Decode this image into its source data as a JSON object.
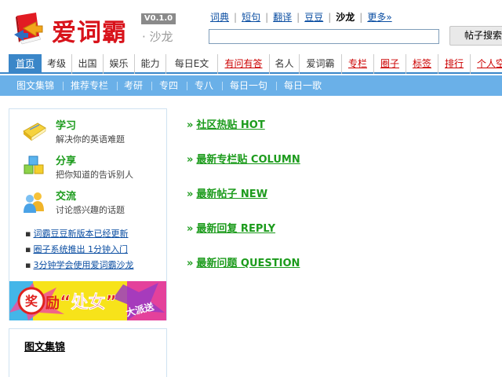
{
  "header": {
    "logo_text": "爱词霸",
    "version": "V0.1.0",
    "salon_label": "· 沙龙",
    "topnav": [
      {
        "label": "词典",
        "underline": true
      },
      {
        "label": "短句",
        "underline": true
      },
      {
        "label": "翻译",
        "underline": true
      },
      {
        "label": "豆豆",
        "underline": true
      },
      {
        "label": "沙龙",
        "active": true
      },
      {
        "label": "更多»",
        "underline": true
      }
    ],
    "search_placeholder": "",
    "search_button": "帖子搜索"
  },
  "mainnav": [
    {
      "label": "首页",
      "style": "home"
    },
    {
      "label": "考级"
    },
    {
      "label": "出国"
    },
    {
      "label": "娱乐"
    },
    {
      "label": "能力"
    },
    {
      "label": "每日E文"
    },
    {
      "label": "有问有答",
      "style": "red"
    },
    {
      "label": "名人"
    },
    {
      "label": "爱词霸"
    },
    {
      "label": "专栏",
      "style": "red"
    },
    {
      "label": "圈子",
      "style": "red"
    },
    {
      "label": "标签",
      "style": "red"
    },
    {
      "label": "排行",
      "style": "red"
    },
    {
      "label": "个人空",
      "style": "red"
    }
  ],
  "subnav": [
    "图文集锦",
    "推荐专栏",
    "考研",
    "专四",
    "专八",
    "每日一句",
    "每日一歌"
  ],
  "sidebar": {
    "features": [
      {
        "title": "学习",
        "desc": "解决你的英语难题",
        "icon": "book-icon"
      },
      {
        "title": "分享",
        "desc": "把你知道的告诉别人",
        "icon": "cubes-icon"
      },
      {
        "title": "交流",
        "desc": "讨论感兴趣的话题",
        "icon": "people-icon"
      }
    ],
    "news": [
      "词霸豆豆新版本已经更新",
      "圈子系统推出 1分钟入门",
      "3分钟学会使用爱词霸沙龙"
    ],
    "banner_text_1": "奖",
    "banner_text_2": "励",
    "banner_text_3": "“处女”",
    "banner_text_4": "大派送",
    "box2_title": "图文集锦"
  },
  "content": {
    "arrow": "»",
    "links": [
      "社区热贴 HOT",
      "最新专栏贴 COLUMN",
      "最新帖子 NEW",
      "最新回复 REPLY",
      "最新问题 QUESTION"
    ]
  },
  "colors": {
    "accent_blue": "#3a86c8",
    "subnav_blue": "#6ab0e8",
    "link_green": "#1c9b1c",
    "brand_red": "#d8131b"
  }
}
